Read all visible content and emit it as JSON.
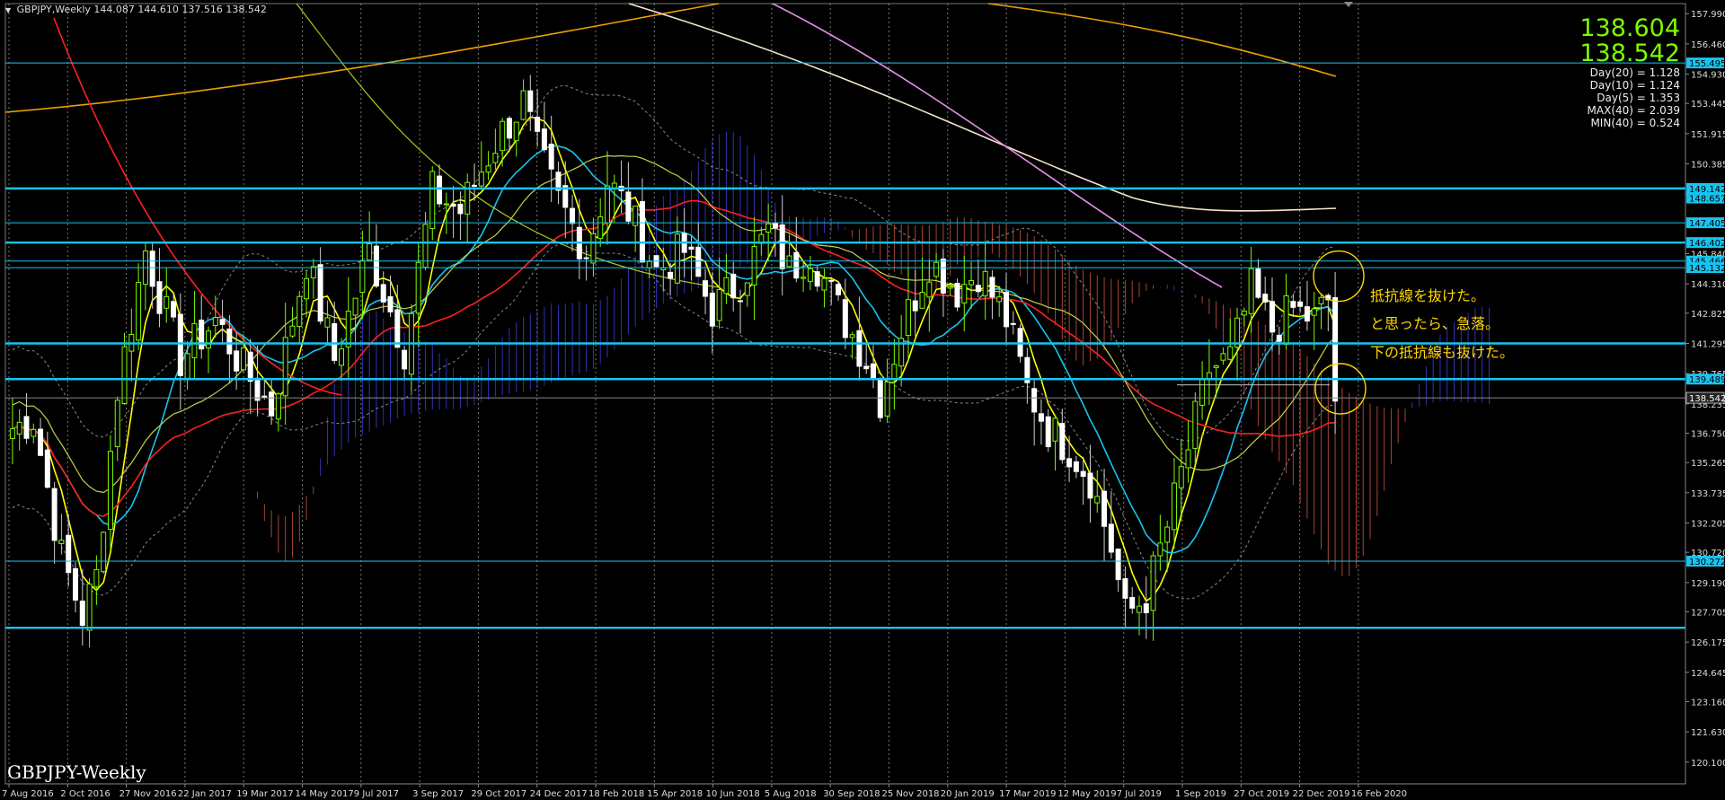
{
  "header": {
    "symbol": "GBPJPY,Weekly",
    "ohlc": "144.087 144.610 137.516 138.542"
  },
  "prices": {
    "bid": "138.604",
    "ask": "138.542"
  },
  "stats": [
    "Day(20) = 1.128",
    "Day(10) = 1.124",
    "Day(5) = 1.353",
    "MAX(40) = 2.039",
    "MIN(40) = 0.524"
  ],
  "annotations": [
    "抵抗線を抜けた。",
    "と思ったら、急落。",
    "下の抵抗線も抜けた。"
  ],
  "watermark": "GBPJPY-Weekly",
  "colors": {
    "background": "#000000",
    "bull": "#7CFC00",
    "bear": "#ffffff",
    "hline": "#17c4f0",
    "annotation": "#ffd700"
  },
  "chart_data": {
    "type": "candlestick",
    "y_range": [
      119.0,
      158.5
    ],
    "y_ticks": [
      "157.990",
      "156.460",
      "154.930",
      "153.445",
      "151.915",
      "150.385",
      "148.855",
      "147.325",
      "145.840",
      "144.310",
      "142.825",
      "141.295",
      "139.765",
      "138.235",
      "136.750",
      "135.265",
      "133.735",
      "132.205",
      "130.720",
      "129.190",
      "127.705",
      "126.175",
      "124.645",
      "123.160",
      "121.630",
      "120.100"
    ],
    "x_labels": [
      "7 Aug 2016",
      "2 Oct 2016",
      "27 Nov 2016",
      "22 Jan 2017",
      "19 Mar 2017",
      "14 May 2017",
      "9 Jul 2017",
      "3 Sep 2017",
      "29 Oct 2017",
      "24 Dec 2017",
      "18 Feb 2018",
      "15 Apr 2018",
      "10 Jun 2018",
      "5 Aug 2018",
      "30 Sep 2018",
      "25 Nov 2018",
      "20 Jan 2019",
      "17 Mar 2019",
      "12 May 2019",
      "7 Jul 2019",
      "1 Sep 2019",
      "27 Oct 2019",
      "22 Dec 2019",
      "16 Feb 2020"
    ],
    "levels": [
      {
        "value": 155.495,
        "label": "155.495"
      },
      {
        "value": 149.142,
        "label": "149.142"
      },
      {
        "value": 148.657,
        "label": "148.657"
      },
      {
        "value": 147.405,
        "label": "147.405"
      },
      {
        "value": 146.402,
        "label": "146.402"
      },
      {
        "value": 145.466,
        "label": "145.466"
      },
      {
        "value": 145.132,
        "label": "145.132"
      },
      {
        "value": 139.489,
        "label": "139.489"
      },
      {
        "value": 130.272,
        "label": "130.272"
      }
    ],
    "thick_lines": [
      149.142,
      146.402,
      141.295,
      139.489,
      126.9
    ],
    "thin_lines": [
      155.495,
      147.405,
      145.466,
      145.132,
      130.272
    ],
    "current_price": {
      "value": 138.542,
      "label": "138.542"
    },
    "anchors": [
      {
        "i": 0,
        "c": 137.0
      },
      {
        "i": 3,
        "c": 137.5
      },
      {
        "i": 7,
        "c": 130.5
      },
      {
        "i": 10,
        "c": 127.5
      },
      {
        "i": 12,
        "c": 129.5
      },
      {
        "i": 15,
        "c": 139.0
      },
      {
        "i": 19,
        "c": 146.0
      },
      {
        "i": 24,
        "c": 140.5
      },
      {
        "i": 29,
        "c": 142.5
      },
      {
        "i": 33,
        "c": 140.0
      },
      {
        "i": 37,
        "c": 138.0
      },
      {
        "i": 42,
        "c": 145.5
      },
      {
        "i": 46,
        "c": 140.5
      },
      {
        "i": 51,
        "c": 146.0
      },
      {
        "i": 56,
        "c": 141.0
      },
      {
        "i": 60,
        "c": 149.0
      },
      {
        "i": 64,
        "c": 148.0
      },
      {
        "i": 69,
        "c": 151.5
      },
      {
        "i": 73,
        "c": 153.5
      },
      {
        "i": 75,
        "c": 151.0
      },
      {
        "i": 78,
        "c": 148.5
      },
      {
        "i": 82,
        "c": 146.0
      },
      {
        "i": 85,
        "c": 149.5
      },
      {
        "i": 88,
        "c": 148.0
      },
      {
        "i": 92,
        "c": 145.0
      },
      {
        "i": 96,
        "c": 146.0
      },
      {
        "i": 100,
        "c": 143.0
      },
      {
        "i": 104,
        "c": 144.5
      },
      {
        "i": 108,
        "c": 147.0
      },
      {
        "i": 111,
        "c": 145.0
      },
      {
        "i": 114,
        "c": 146.0
      },
      {
        "i": 118,
        "c": 143.0
      },
      {
        "i": 122,
        "c": 140.5
      },
      {
        "i": 124,
        "c": 138.5
      },
      {
        "i": 127,
        "c": 142.0
      },
      {
        "i": 131,
        "c": 145.5
      },
      {
        "i": 135,
        "c": 144.0
      },
      {
        "i": 138,
        "c": 145.0
      },
      {
        "i": 142,
        "c": 142.5
      },
      {
        "i": 145,
        "c": 139.0
      },
      {
        "i": 148,
        "c": 137.0
      },
      {
        "i": 151,
        "c": 136.0
      },
      {
        "i": 154,
        "c": 134.5
      },
      {
        "i": 157,
        "c": 131.0
      },
      {
        "i": 159,
        "c": 127.5
      },
      {
        "i": 162,
        "c": 128.5
      },
      {
        "i": 165,
        "c": 132.0
      },
      {
        "i": 168,
        "c": 136.0
      },
      {
        "i": 171,
        "c": 140.0
      },
      {
        "i": 174,
        "c": 140.5
      },
      {
        "i": 177,
        "c": 144.0
      },
      {
        "i": 180,
        "c": 142.0
      },
      {
        "i": 183,
        "c": 143.0
      },
      {
        "i": 186,
        "c": 142.5
      },
      {
        "i": 188,
        "c": 143.5
      },
      {
        "i": 189,
        "c": 138.5
      }
    ],
    "candle_count": 190
  }
}
